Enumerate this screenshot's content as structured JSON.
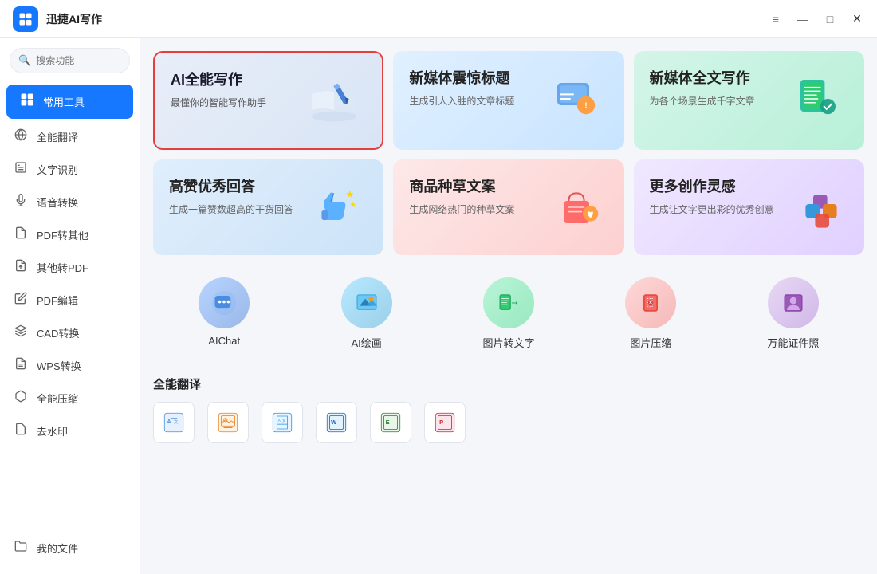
{
  "app": {
    "title": "迅捷AI写作",
    "logo_alt": "app-logo"
  },
  "title_controls": {
    "menu": "≡",
    "minimize": "—",
    "maximize": "□",
    "close": "✕"
  },
  "sidebar": {
    "search_placeholder": "搜索功能",
    "items": [
      {
        "id": "common-tools",
        "label": "常用工具",
        "icon": "🧰",
        "active": true
      },
      {
        "id": "translate",
        "label": "全能翻译",
        "icon": "🔄"
      },
      {
        "id": "ocr",
        "label": "文字识别",
        "icon": "🔤"
      },
      {
        "id": "voice",
        "label": "语音转换",
        "icon": "🎙️"
      },
      {
        "id": "pdf-to-other",
        "label": "PDF转其他",
        "icon": "📄"
      },
      {
        "id": "other-to-pdf",
        "label": "其他转PDF",
        "icon": "📃"
      },
      {
        "id": "pdf-edit",
        "label": "PDF编辑",
        "icon": "✏️"
      },
      {
        "id": "cad",
        "label": "CAD转换",
        "icon": "📐"
      },
      {
        "id": "wps",
        "label": "WPS转换",
        "icon": "📝"
      },
      {
        "id": "compress",
        "label": "全能压缩",
        "icon": "🗜️"
      },
      {
        "id": "watermark",
        "label": "去水印",
        "icon": "💧"
      }
    ],
    "bottom_items": [
      {
        "id": "my-files",
        "label": "我的文件",
        "icon": "📁"
      }
    ]
  },
  "feature_cards": [
    {
      "id": "ai-writing",
      "title": "AI全能写作",
      "desc": "最懂你的智能写作助手",
      "bg": "featured",
      "icon_color": "#5b8def"
    },
    {
      "id": "new-media-title",
      "title": "新媒体震惊标题",
      "desc": "生成引人入胜的文章标题",
      "bg": "blue",
      "icon_color": "#4da6ff"
    },
    {
      "id": "new-media-full",
      "title": "新媒体全文写作",
      "desc": "为各个场景生成千字文章",
      "bg": "green",
      "icon_color": "#2ed573"
    },
    {
      "id": "high-praise",
      "title": "高赞优秀回答",
      "desc": "生成一篇赞数超高的干货回答",
      "bg": "lightblue",
      "icon_color": "#4dabff"
    },
    {
      "id": "product-copy",
      "title": "商品种草文案",
      "desc": "生成网络热门的种草文案",
      "bg": "pink",
      "icon_color": "#ff6b6b"
    },
    {
      "id": "more-creativity",
      "title": "更多创作灵感",
      "desc": "生成让文字更出彩的优秀创意",
      "bg": "purple",
      "icon_color": "#9b59b6"
    }
  ],
  "icon_tools": [
    {
      "id": "ai-chat",
      "label": "AIChat",
      "bg": "#d6e8ff",
      "icon": "💬"
    },
    {
      "id": "ai-draw",
      "label": "AI绘画",
      "bg": "#d0eeff",
      "icon": "🖼️"
    },
    {
      "id": "img-to-text",
      "label": "图片转文字",
      "bg": "#d0f5e8",
      "icon": "🔤"
    },
    {
      "id": "img-compress",
      "label": "图片压缩",
      "bg": "#ffd6d6",
      "icon": "🗜️"
    },
    {
      "id": "id-photo",
      "label": "万能证件照",
      "bg": "#e8d6f5",
      "icon": "👤"
    }
  ],
  "section_translate": {
    "title": "全能翻译"
  },
  "bottom_icons": [
    {
      "id": "translate-doc",
      "label": "",
      "icon": "🔄"
    },
    {
      "id": "translate-img",
      "label": "",
      "icon": "🖼️"
    },
    {
      "id": "translate-doc2",
      "label": "",
      "icon": "📄"
    },
    {
      "id": "translate-word",
      "label": "",
      "icon": "📝"
    },
    {
      "id": "translate-excel",
      "label": "",
      "icon": "📊"
    },
    {
      "id": "translate-ppt",
      "label": "",
      "icon": "📋"
    }
  ]
}
